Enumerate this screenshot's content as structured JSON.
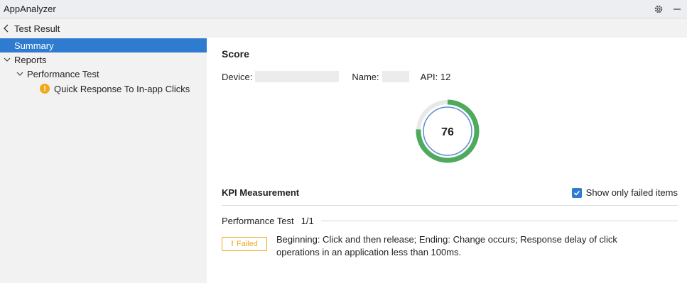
{
  "app": {
    "title": "AppAnalyzer"
  },
  "nav": {
    "back_label": "Test Result"
  },
  "sidebar": {
    "items": [
      {
        "label": "Summary"
      },
      {
        "label": "Reports"
      },
      {
        "label": "Performance Test"
      },
      {
        "label": "Quick Response To In-app Clicks"
      }
    ]
  },
  "score": {
    "title": "Score",
    "device_label": "Device:",
    "name_label": "Name:",
    "api_label": "API: 12",
    "value": "76",
    "fraction": 0.76
  },
  "kpi": {
    "title": "KPI Measurement",
    "show_failed_label": "Show only failed items",
    "show_failed_checked": true,
    "section_name": "Performance Test",
    "section_count": "1/1",
    "status_badge": "Failed",
    "description": "Beginning: Click and then release; Ending: Change occurs; Response delay of click operations in an application less than 100ms."
  },
  "colors": {
    "accent": "#2e7bcf",
    "gauge_green": "#4faa5e",
    "gauge_ring": "#5b8fcf",
    "warning": "#f0a81c"
  }
}
